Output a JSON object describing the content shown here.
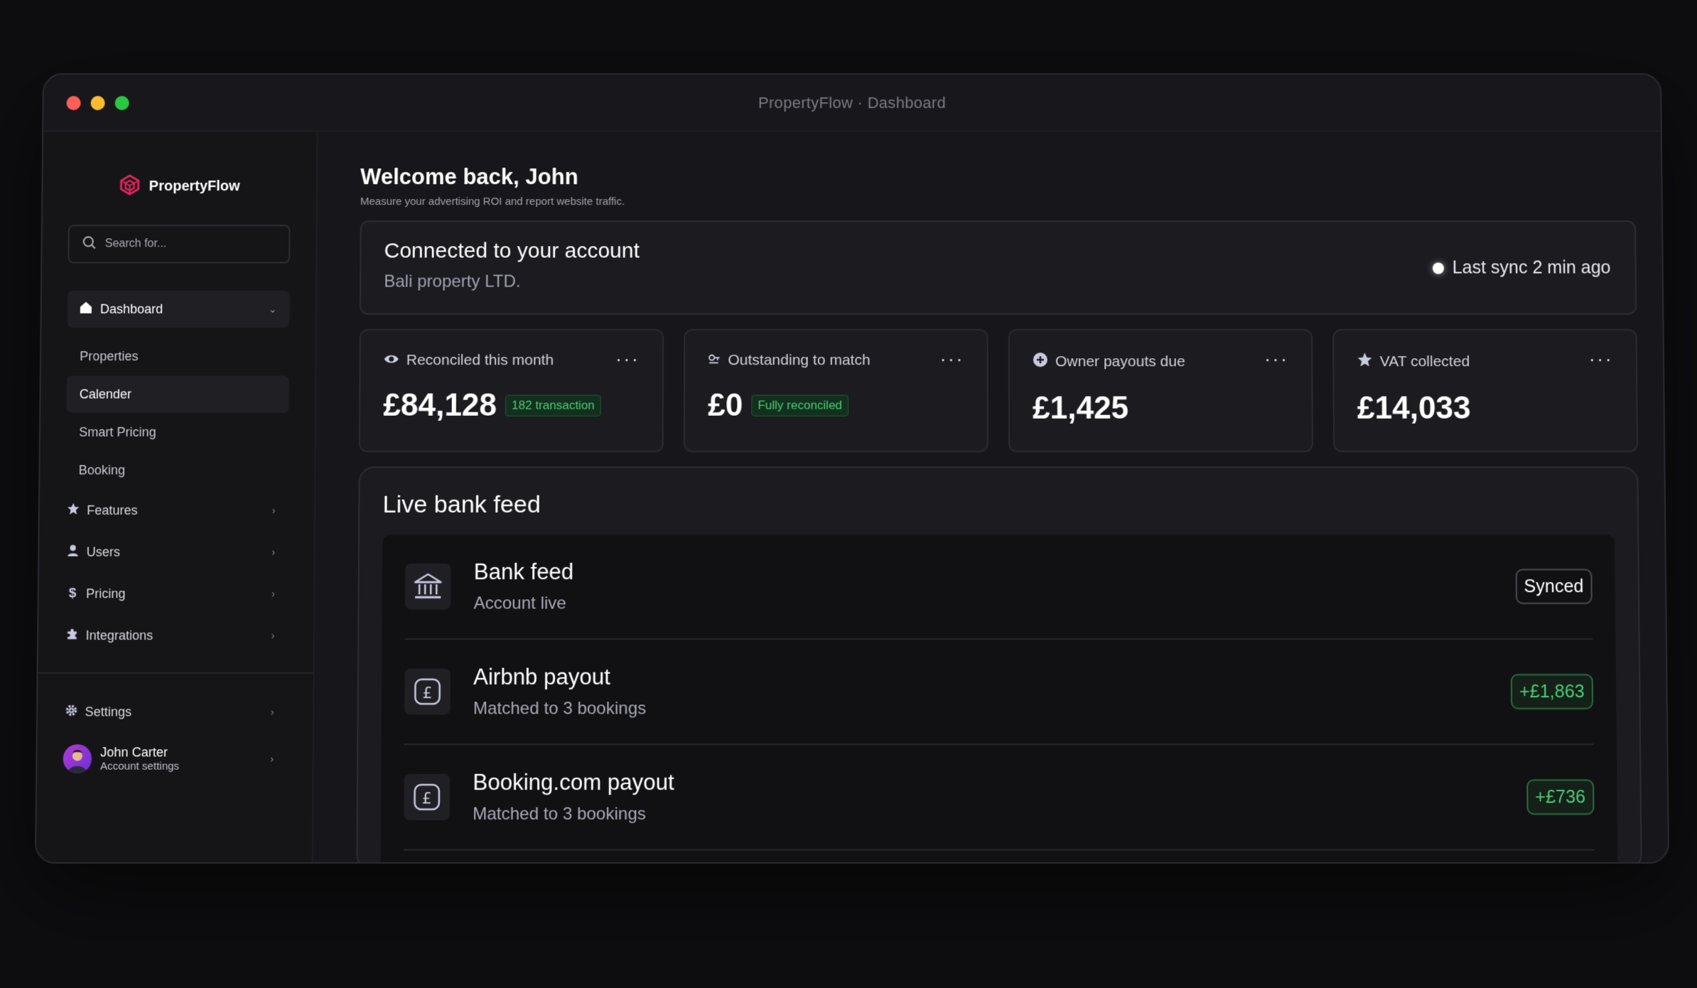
{
  "window": {
    "title": "PropertyFlow · Dashboard",
    "lights": [
      "#ff5f57",
      "#febc2e",
      "#28c840"
    ]
  },
  "sidebar": {
    "brand": "PropertyFlow",
    "brand_color": "#e0245e",
    "search_placeholder": "Search for...",
    "main_item": "Dashboard",
    "sub_items": [
      "Properties",
      "Calender",
      "Smart Pricing",
      "Booking"
    ],
    "active_sub": "Calender",
    "nav_items": [
      {
        "label": "Features",
        "icon": "star-icon"
      },
      {
        "label": "Users",
        "icon": "user-icon"
      },
      {
        "label": "Pricing",
        "icon": "dollar-icon"
      },
      {
        "label": "Integrations",
        "icon": "puzzle-icon"
      }
    ],
    "settings": "Settings",
    "user": {
      "name": "John Carter",
      "sub": "Account settings"
    }
  },
  "main": {
    "welcome": "Welcome back, John",
    "welcome_sub": "Measure your advertising ROI and report website traffic.",
    "connection": {
      "title": "Connected to your account",
      "sub": "Bali property LTD.",
      "sync": "Last sync 2 min ago"
    },
    "stats": [
      {
        "label": "Reconciled this month",
        "value": "£84,128",
        "badge": "182 transaction",
        "icon": "eye-icon"
      },
      {
        "label": "Outstanding to match",
        "value": "£0",
        "badge": "Fully reconciled",
        "icon": "key-icon"
      },
      {
        "label": "Owner payouts due",
        "value": "£1,425",
        "badge": "",
        "icon": "plus-circle-icon"
      },
      {
        "label": "VAT collected",
        "value": "£14,033",
        "badge": "",
        "icon": "star-icon"
      }
    ],
    "feed": {
      "title": "Live bank feed",
      "rows": [
        {
          "name": "Bank feed",
          "desc": "Account live",
          "pill": "Synced",
          "pill_style": "white",
          "icon": "bank-icon"
        },
        {
          "name": "Airbnb payout",
          "desc": "Matched to 3 bookings",
          "pill": "+£1,863",
          "pill_style": "green",
          "icon": "pound-icon"
        },
        {
          "name": "Booking.com payout",
          "desc": "Matched to 3 bookings",
          "pill": "+£736",
          "pill_style": "green",
          "icon": "pound-icon"
        }
      ]
    },
    "colors": {
      "positive": "#4ccd78"
    }
  }
}
